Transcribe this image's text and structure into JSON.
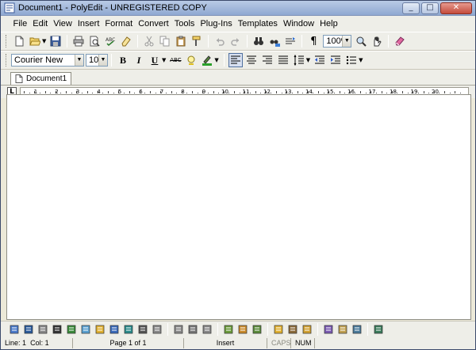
{
  "window": {
    "title": "Document1 - PolyEdit - UNREGISTERED COPY",
    "controls": {
      "minimize": "_",
      "maximize": "□",
      "close": "✕"
    }
  },
  "menu": [
    "File",
    "Edit",
    "View",
    "Insert",
    "Format",
    "Convert",
    "Tools",
    "Plug-Ins",
    "Templates",
    "Window",
    "Help"
  ],
  "toolbar": {
    "zoom": "100%",
    "pilcrow": "¶"
  },
  "format_bar": {
    "font": "Courier New",
    "size": "10",
    "bold": "B",
    "italic": "I",
    "underline": "U",
    "strikethrough": "ABC",
    "alignment_active": "left"
  },
  "tabs": [
    {
      "label": "Document1",
      "icon": "document-icon"
    }
  ],
  "ruler": {
    "corner": "L",
    "numbers": [
      "1",
      "2",
      "3",
      "4",
      "5",
      "6",
      "7",
      "8",
      "9",
      "10",
      "11",
      "12",
      "13",
      "14",
      "15",
      "16",
      "17",
      "18",
      "19",
      "20"
    ]
  },
  "status": {
    "line_label": "Line:",
    "line_value": "1",
    "col_label": "Col:",
    "col_value": "1",
    "page": "Page 1 of 1",
    "mode": "Insert",
    "caps": "CAPS",
    "num": "NUM"
  },
  "colors": {
    "title_bar": "#9fb6dc",
    "chrome": "#eeeee8",
    "document": "#ffffff",
    "close_button": "#c44b3b"
  }
}
